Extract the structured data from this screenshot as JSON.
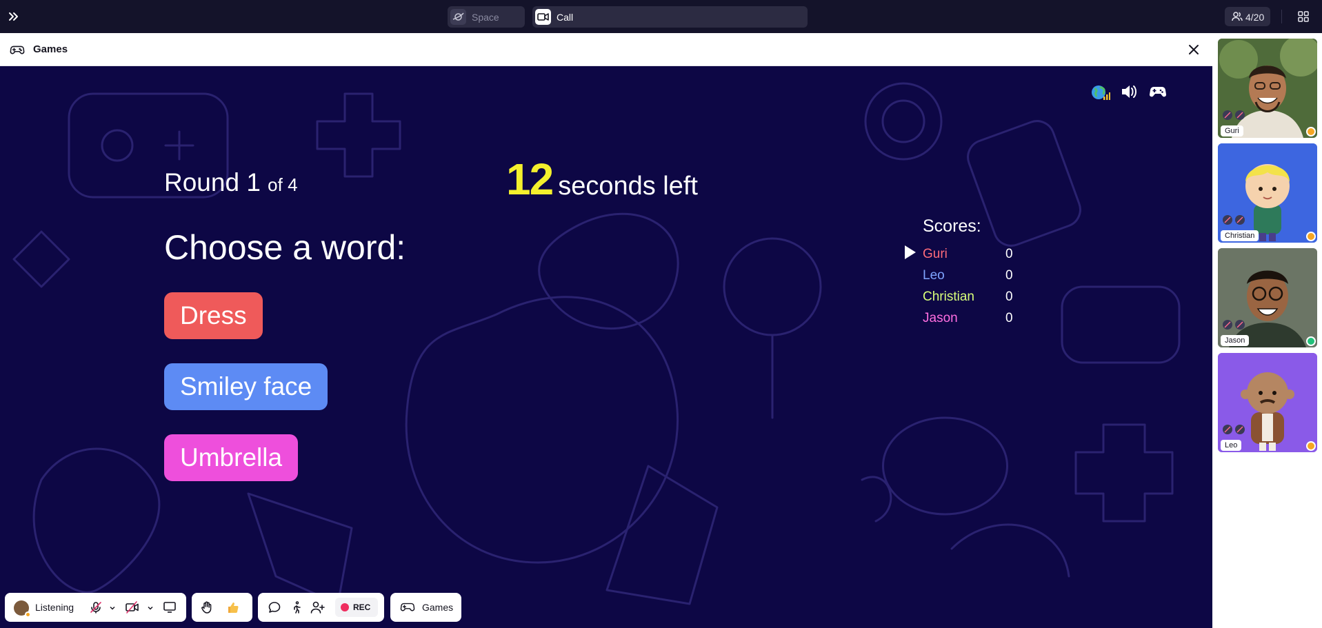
{
  "topbar": {
    "space_label": "Space",
    "call_label": "Call",
    "participants": "4/20"
  },
  "panel": {
    "title": "Games"
  },
  "game": {
    "round_label": "Round",
    "round_current": "1",
    "round_of": "of 4",
    "seconds": "12",
    "seconds_label": "seconds left",
    "prompt": "Choose a word:",
    "words": [
      {
        "label": "Dress",
        "color": "#ef5a5a"
      },
      {
        "label": "Smiley face",
        "color": "#5d8bf4"
      },
      {
        "label": "Umbrella",
        "color": "#ee4fdc"
      }
    ],
    "scores_title": "Scores:",
    "scores": [
      {
        "name": "Guri",
        "score": "0",
        "color": "#ff6b7a",
        "current_turn": true
      },
      {
        "name": "Leo",
        "score": "0",
        "color": "#7fa4ff",
        "current_turn": false
      },
      {
        "name": "Christian",
        "score": "0",
        "color": "#d8ff7a",
        "current_turn": false
      },
      {
        "name": "Jason",
        "score": "0",
        "color": "#ff6ee0",
        "current_turn": false
      }
    ],
    "background_color": "#0d0745",
    "accent_color": "#f4f02d"
  },
  "bottombar": {
    "status_label": "Listening",
    "rec_label": "REC",
    "games_label": "Games"
  },
  "participants": [
    {
      "name": "Guri",
      "status_color": "#f5a623"
    },
    {
      "name": "Christian",
      "status_color": "#f5a623"
    },
    {
      "name": "Jason",
      "status_color": "#22c17a"
    },
    {
      "name": "Leo",
      "status_color": "#f5a623"
    }
  ]
}
